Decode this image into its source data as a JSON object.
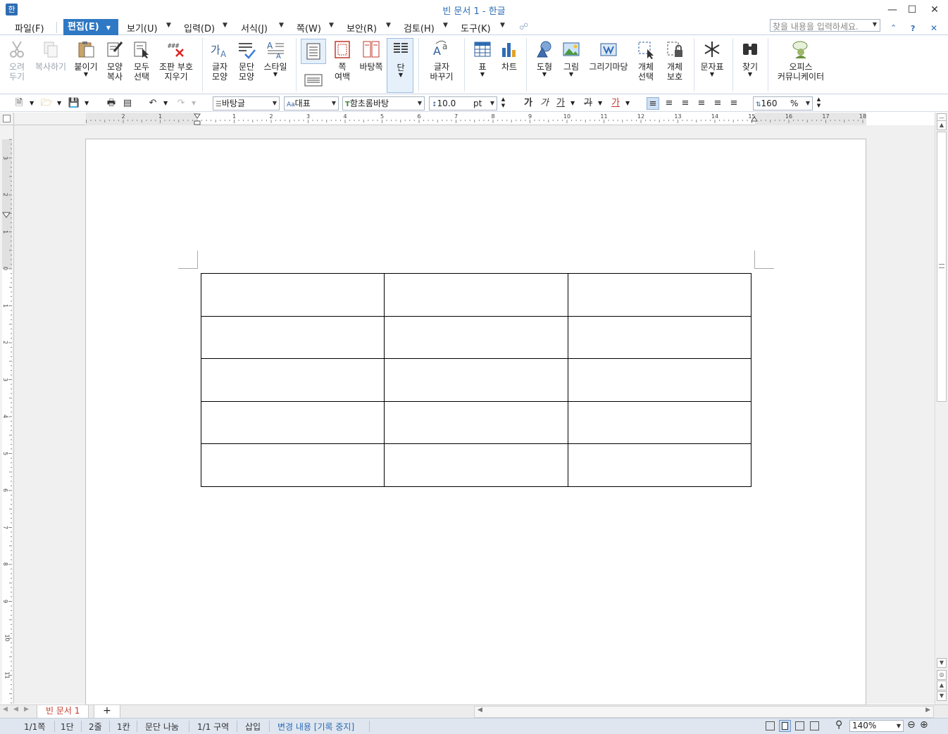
{
  "window": {
    "title": "빈 문서 1 - 한글",
    "app_icon": "한"
  },
  "menu": {
    "items": [
      {
        "label": "파일(F)"
      },
      {
        "label": "편집(E)",
        "active": true
      },
      {
        "label": "보기(U)"
      },
      {
        "label": "입력(D)"
      },
      {
        "label": "서식(J)"
      },
      {
        "label": "쪽(W)"
      },
      {
        "label": "보안(R)"
      },
      {
        "label": "검토(H)"
      },
      {
        "label": "도구(K)"
      }
    ],
    "search_placeholder": "찾을 내용을 입력하세요."
  },
  "ribbon": {
    "cut": "오려\n두기",
    "copy": "복사하기",
    "paste": "붙이기",
    "format_copy": "모양\n복사",
    "select_all": "모두\n선택",
    "clear_marks": "조판 부호\n지우기",
    "char_shape": "글자\n모양",
    "para_shape": "문단\n모양",
    "style": "스타일",
    "page_margin": "쪽\n여백",
    "master_page": "바탕쪽",
    "column": "단",
    "char_replace": "글자\n바꾸기",
    "table": "표",
    "chart": "차트",
    "shape": "도형",
    "picture": "그림",
    "gallery": "그리기마당",
    "obj_select": "개체\n선택",
    "obj_protect": "개체\n보호",
    "char_map": "문자표",
    "find": "찾기",
    "community": "오피스\n커뮤니케이터"
  },
  "formatbar": {
    "style": "바탕글",
    "lang": "대표",
    "font": "함초롬바탕",
    "size": "10.0",
    "size_unit": "pt",
    "bold": "가",
    "italic": "가",
    "underline": "가",
    "strike": "가",
    "color": "가",
    "line_spacing": "160",
    "line_spacing_unit": "%"
  },
  "ruler": {
    "h_labels": [
      "2",
      "1",
      "1",
      "2",
      "3",
      "4",
      "5",
      "6",
      "7",
      "8",
      "9",
      "10",
      "11",
      "12",
      "13",
      "14",
      "15",
      "16",
      "17",
      "18"
    ],
    "v_labels": [
      "3",
      "2",
      "1",
      "0",
      "1",
      "2",
      "3",
      "4",
      "5",
      "6",
      "7",
      "8",
      "9",
      "10",
      "11"
    ]
  },
  "table": {
    "rows": 5,
    "cols": 3
  },
  "tabs": {
    "doc_tab": "빈 문서 1",
    "add": "+"
  },
  "status": {
    "page": "1/1쪽",
    "column": "1단",
    "line": "2줄",
    "cell": "1칸",
    "para_break": "문단 나눔",
    "section": "1/1 구역",
    "insert": "삽입",
    "track": "변경 내용 [기록 중지]",
    "zoom": "140%"
  },
  "colors": {
    "accent": "#2f78c4",
    "title": "#2b6cb5",
    "tab_text": "#c0392b"
  }
}
